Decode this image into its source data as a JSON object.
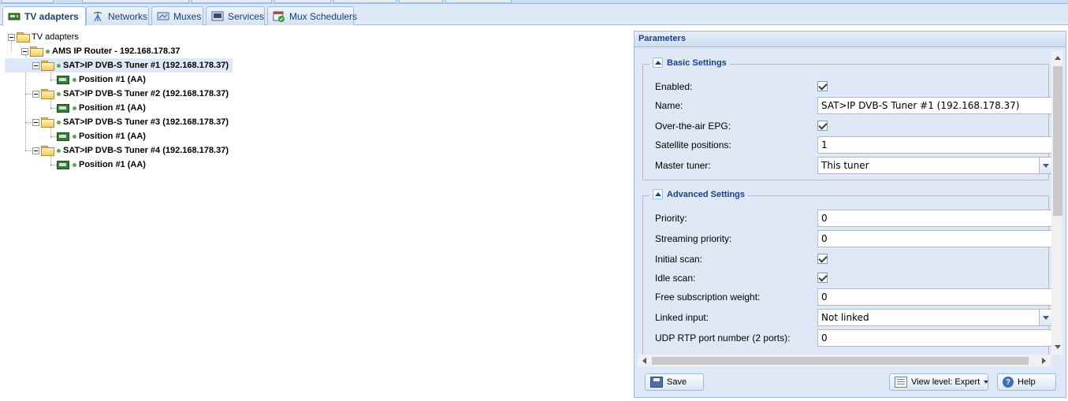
{
  "tabs": [
    {
      "label": "TV adapters",
      "icon": "tv-adapter-icon",
      "active": true
    },
    {
      "label": "Networks",
      "icon": "network-antenna-icon",
      "active": false
    },
    {
      "label": "Muxes",
      "icon": "muxes-icon",
      "active": false
    },
    {
      "label": "Services",
      "icon": "services-icon",
      "active": false
    },
    {
      "label": "Mux Schedulers",
      "icon": "mux-scheduler-icon",
      "active": false
    }
  ],
  "tree": {
    "root": "TV adapters",
    "router": "AMS IP Router - 192.168.178.37",
    "tuners": [
      {
        "name": "SAT>IP DVB-S Tuner #1 (192.168.178.37)",
        "position": "Position #1 (AA)",
        "selected": true
      },
      {
        "name": "SAT>IP DVB-S Tuner #2 (192.168.178.37)",
        "position": "Position #1 (AA)",
        "selected": false
      },
      {
        "name": "SAT>IP DVB-S Tuner #3 (192.168.178.37)",
        "position": "Position #1 (AA)",
        "selected": false
      },
      {
        "name": "SAT>IP DVB-S Tuner #4 (192.168.178.37)",
        "position": "Position #1 (AA)",
        "selected": false
      }
    ],
    "status_color": "#4caf50"
  },
  "params": {
    "title": "Parameters",
    "basic": {
      "legend": "Basic Settings",
      "enabled_label": "Enabled:",
      "enabled": true,
      "name_label": "Name:",
      "name_value": "SAT>IP DVB-S Tuner #1 (192.168.178.37)",
      "epg_label": "Over-the-air EPG:",
      "epg": true,
      "satpos_label": "Satellite positions:",
      "satpos_value": "1",
      "master_label": "Master tuner:",
      "master_value": "This tuner"
    },
    "advanced": {
      "legend": "Advanced Settings",
      "priority_label": "Priority:",
      "priority_value": "0",
      "streaming_label": "Streaming priority:",
      "streaming_value": "0",
      "initial_scan_label": "Initial scan:",
      "initial_scan": true,
      "idle_scan_label": "Idle scan:",
      "idle_scan": true,
      "free_sub_label": "Free subscription weight:",
      "free_sub_value": "0",
      "linked_label": "Linked input:",
      "linked_value": "Not linked",
      "udp_label": "UDP RTP port number (2 ports):",
      "udp_value": "0"
    }
  },
  "buttons": {
    "save": "Save",
    "view_level": "View level: Expert",
    "help": "Help"
  },
  "colors": {
    "accent": "#15428b",
    "panel_bg": "#dfe8f6",
    "border": "#99bbe8",
    "selection": "#dfe8f6"
  }
}
